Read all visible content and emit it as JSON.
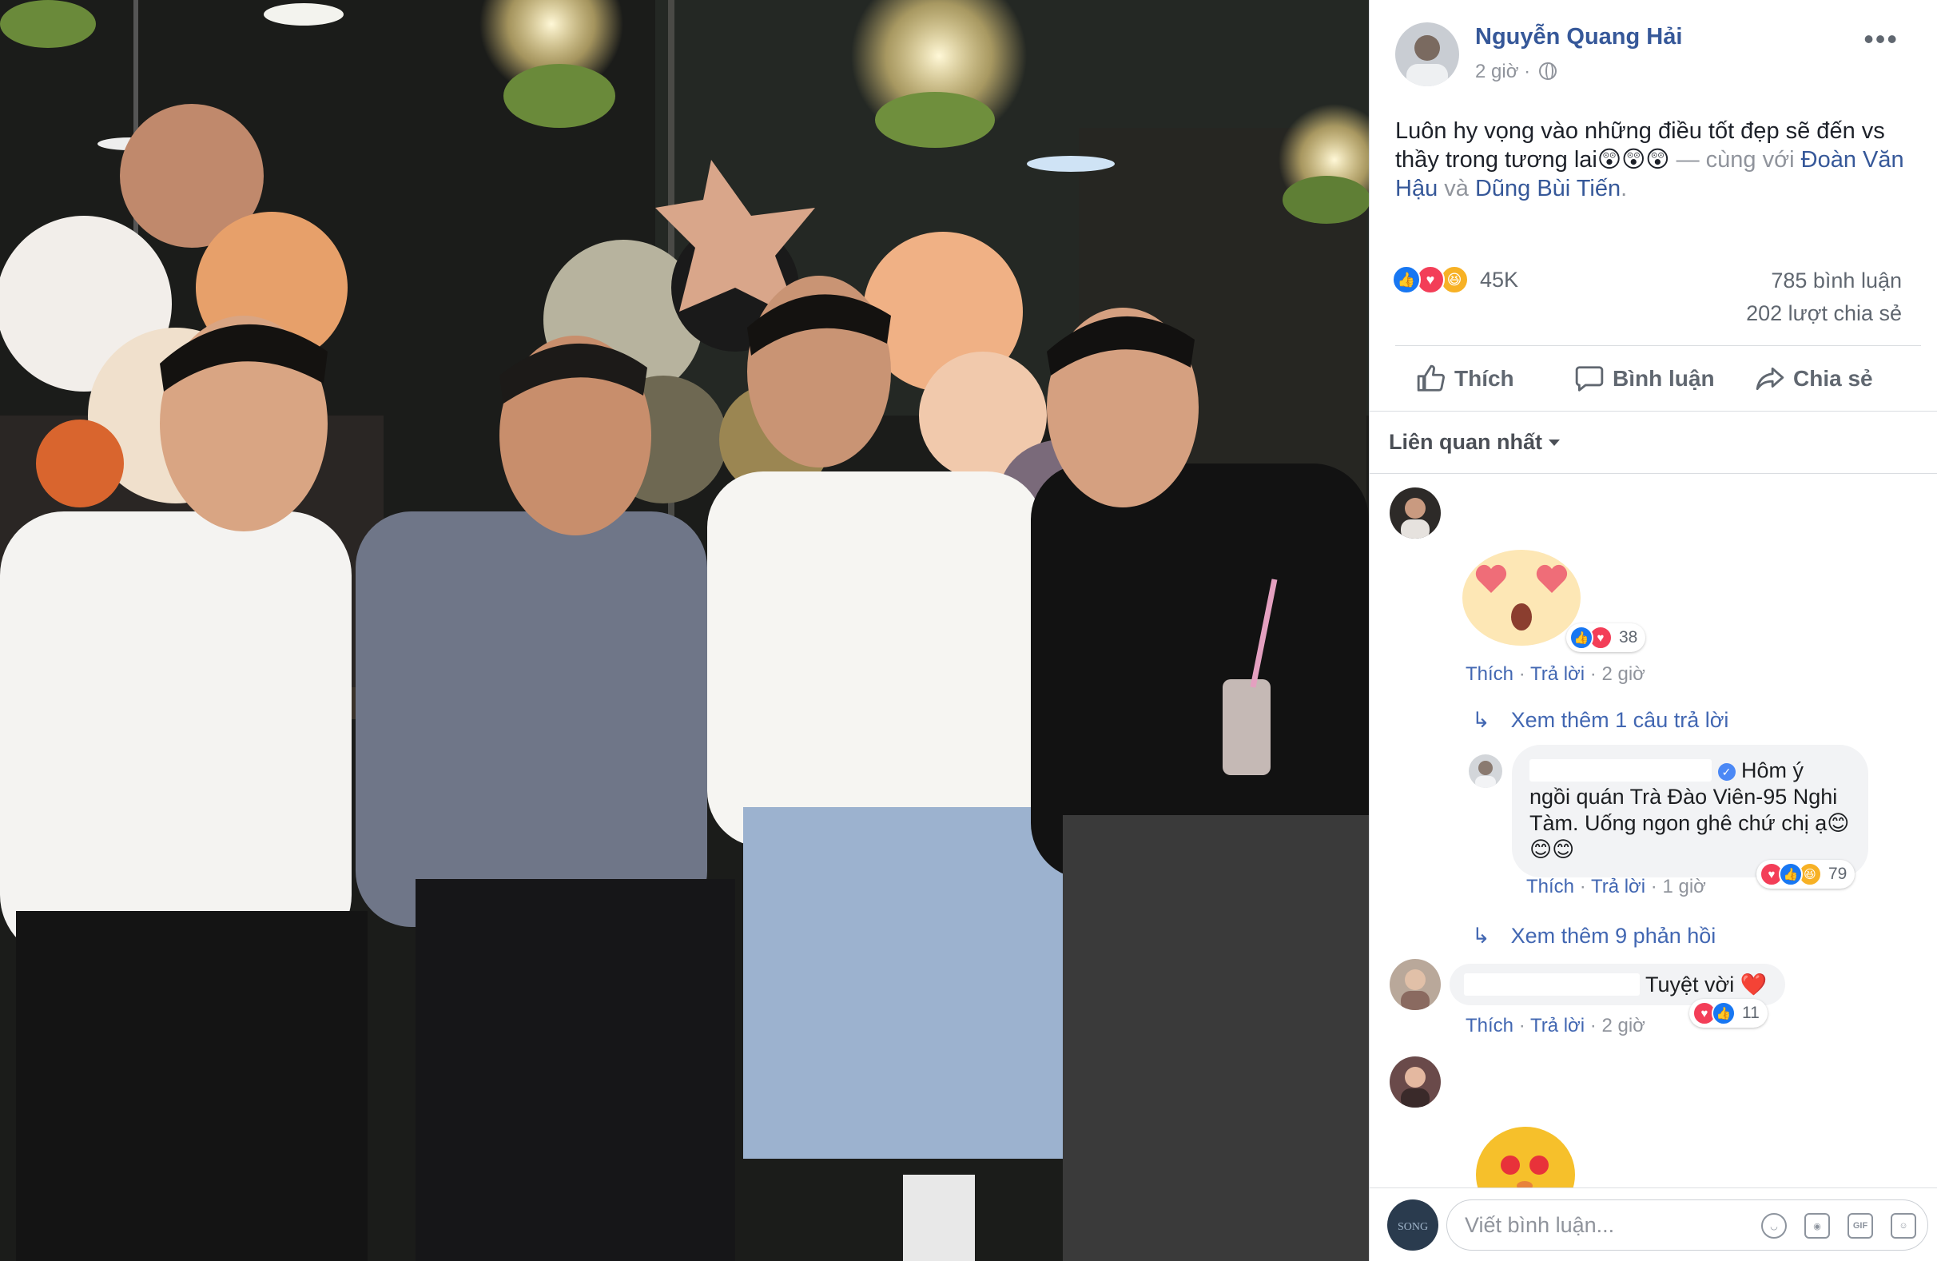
{
  "post": {
    "author": "Nguyễn Quang Hải",
    "time": "2 giờ ·",
    "text": "Luôn hy vọng vào những điều tốt đẹp sẽ đến vs thầy trong tương lai😲😲😲",
    "with_label": " — cùng với ",
    "tag1": "Đoàn Văn Hậu",
    "and_label": " và ",
    "tag2": "Dũng Bùi Tiến",
    "tail": "."
  },
  "stats": {
    "reaction_count": "45K",
    "comments": "785 bình luận",
    "shares": "202 lượt chia sẻ"
  },
  "actions": {
    "like": "Thích",
    "comment": "Bình luận",
    "share": "Chia sẻ"
  },
  "sort": {
    "label": "Liên quan nhất"
  },
  "comments": [
    {
      "reaction_count": "38",
      "meta_like": "Thích",
      "meta_reply": "Trả lời",
      "meta_time": "2 giờ"
    },
    {
      "more_replies": "Xem thêm 1 câu trả lời"
    },
    {
      "text_start": "Hôm ý",
      "text_rest": "ngồi quán Trà Đào Viên-95 Nghi Tàm. Uống ngon ghê chứ chị ạ😊😊😊",
      "reaction_count": "79",
      "meta_like": "Thích",
      "meta_reply": "Trả lời",
      "meta_time": "1 giờ"
    },
    {
      "more_replies": "Xem thêm 9 phản hồi"
    },
    {
      "text": "Tuyệt vời ❤️",
      "reaction_count": "11",
      "meta_like": "Thích",
      "meta_reply": "Trả lời",
      "meta_time": "2 giờ"
    }
  ],
  "composer": {
    "placeholder": "Viết bình luận...",
    "icons": [
      "emoji-icon",
      "camera-icon",
      "gif-icon",
      "sticker-icon"
    ],
    "gif": "GIF"
  },
  "colors": {
    "link": "#365899",
    "like_blue": "#1877f2",
    "love_red": "#f33e58",
    "haha_yellow": "#f7b125",
    "meta_gray": "#90949c"
  }
}
